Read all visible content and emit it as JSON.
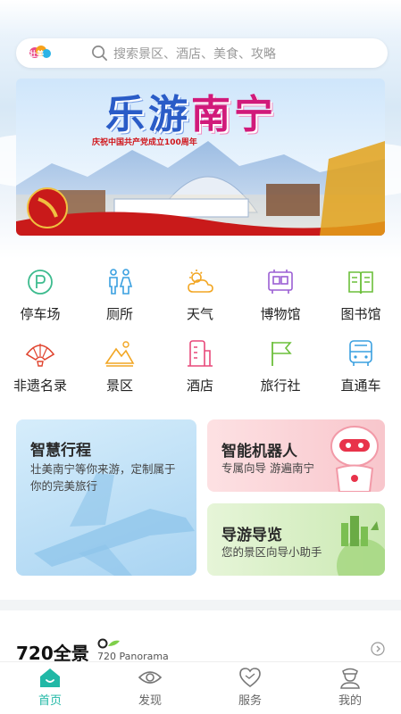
{
  "search": {
    "logo_text": "壮美",
    "placeholder": "搜索景区、酒店、美食、攻略"
  },
  "banner": {
    "title_part1": "乐游",
    "title_part2": "南宁",
    "subtitle": "庆祝中国共产党成立100周年"
  },
  "services": [
    {
      "label": "停车场",
      "icon": "parking-icon"
    },
    {
      "label": "厕所",
      "icon": "toilet-icon"
    },
    {
      "label": "天气",
      "icon": "weather-icon"
    },
    {
      "label": "博物馆",
      "icon": "museum-icon"
    },
    {
      "label": "图书馆",
      "icon": "library-icon"
    },
    {
      "label": "非遗名录",
      "icon": "heritage-fan-icon"
    },
    {
      "label": "景区",
      "icon": "scenic-mountain-icon"
    },
    {
      "label": "酒店",
      "icon": "hotel-icon"
    },
    {
      "label": "旅行社",
      "icon": "flag-icon"
    },
    {
      "label": "直通车",
      "icon": "bus-icon"
    }
  ],
  "cards": {
    "smart_trip": {
      "title": "智慧行程",
      "desc": "壮美南宁等你来游，定制属于你的完美旅行"
    },
    "robot": {
      "title": "智能机器人",
      "desc": "专属向导 游遍南宁"
    },
    "guide": {
      "title": "导游导览",
      "desc": "您的景区向导小助手"
    }
  },
  "panorama": {
    "title": "720全景",
    "subtitle": "720 Panorama"
  },
  "tabbar": {
    "items": [
      {
        "label": "首页",
        "icon": "home-icon"
      },
      {
        "label": "发现",
        "icon": "eye-icon"
      },
      {
        "label": "服务",
        "icon": "heart-icon"
      },
      {
        "label": "我的",
        "icon": "user-icon"
      }
    ]
  },
  "colors": {
    "accent": "#21b8a6",
    "tab_inactive": "#666666"
  }
}
